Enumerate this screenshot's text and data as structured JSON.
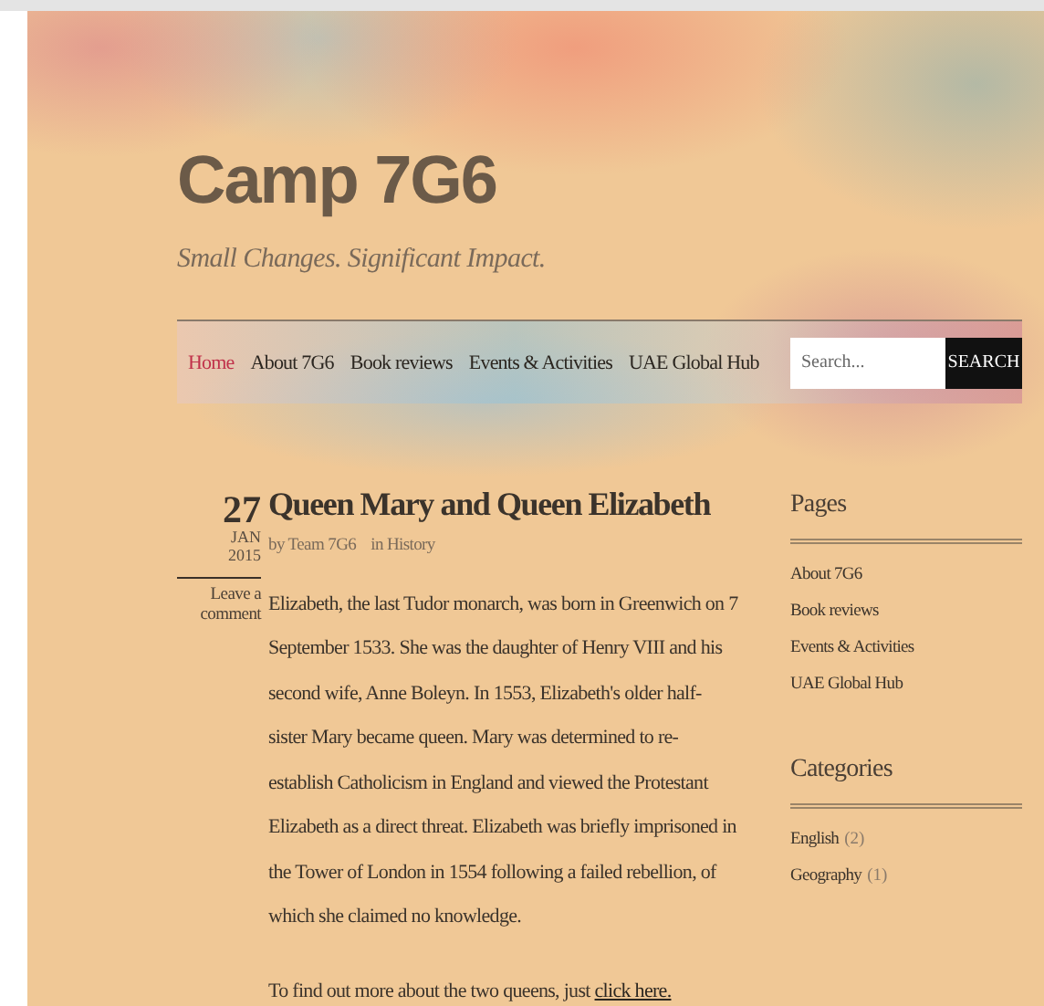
{
  "site": {
    "title": "Camp 7G6",
    "tagline": "Small Changes. Significant Impact."
  },
  "nav": [
    {
      "label": "Home",
      "selected": true
    },
    {
      "label": "About 7G6",
      "selected": false
    },
    {
      "label": "Book reviews",
      "selected": false
    },
    {
      "label": "Events & Activities",
      "selected": false
    },
    {
      "label": "UAE Global Hub",
      "selected": false
    }
  ],
  "search": {
    "placeholder": "Search...",
    "button": "SEARCH"
  },
  "post": {
    "day": "27",
    "month": "JAN",
    "year": "2015",
    "title": "Queen Mary and Queen Elizabeth",
    "author": "by Team 7G6",
    "category": "in History",
    "comment_link": "Leave a comment",
    "body": "Elizabeth, the last Tudor monarch, was born in Greenwich on 7 September 1533. She was the daughter of Henry VIII and his second wife, Anne Boleyn.  In 1553, Elizabeth's older half-sister Mary became queen. Mary was determined to re-establish Catholicism in England and viewed the Protestant Elizabeth as a direct threat. Elizabeth was briefly imprisoned in the Tower of London in 1554 following a failed rebellion, of which she claimed no knowledge.",
    "more_text": "To find out more about the two queens, just",
    "more_link": "click here."
  },
  "sidebar": [
    {
      "heading": "Pages",
      "items": [
        {
          "label": "About 7G6"
        },
        {
          "label": "Book reviews"
        },
        {
          "label": "Events & Activities"
        },
        {
          "label": "UAE Global Hub"
        }
      ]
    },
    {
      "heading": "Categories",
      "items": [
        {
          "label": "English",
          "count": "(2)"
        },
        {
          "label": "Geography",
          "count": "(1)"
        }
      ]
    }
  ]
}
